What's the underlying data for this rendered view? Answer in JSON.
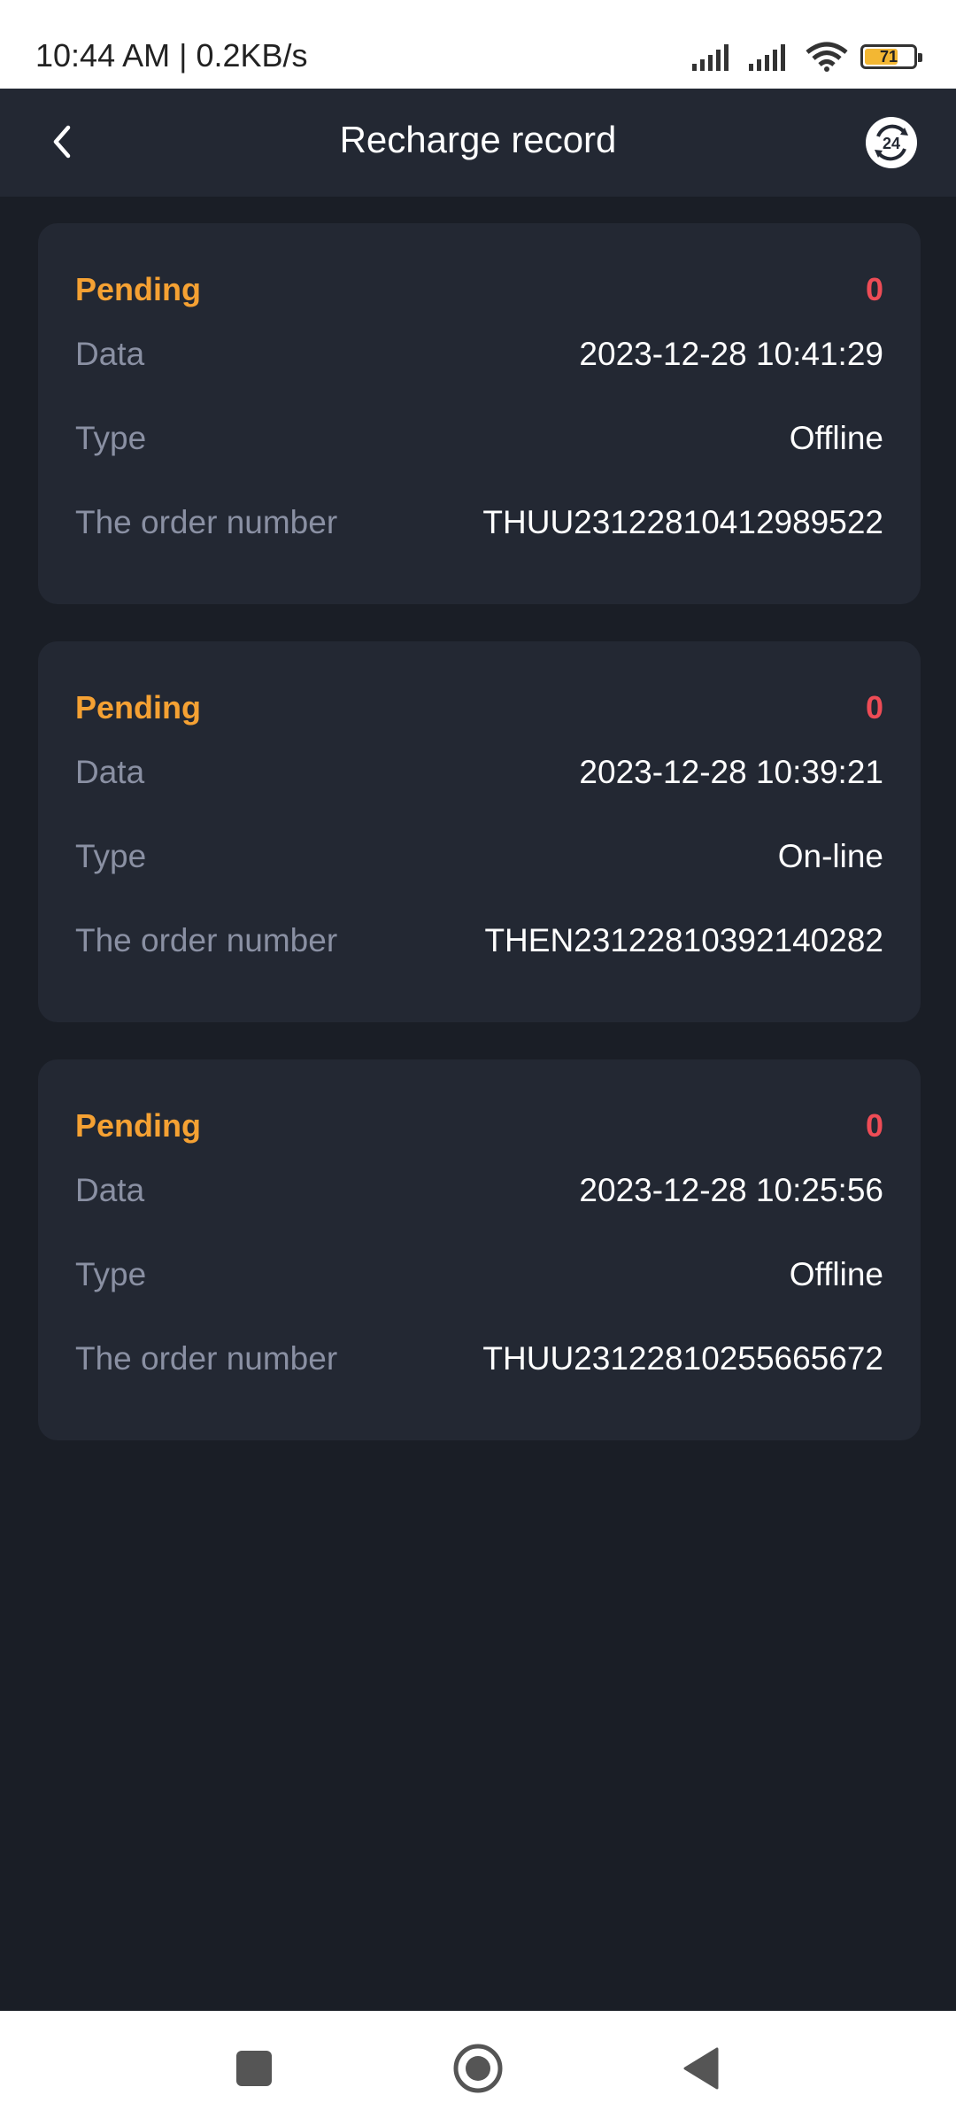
{
  "status_bar": {
    "time": "10:44 AM | 0.2KB/s",
    "battery_level": "71",
    "battery_fraction": 0.71,
    "battery_color": "#f3b733"
  },
  "header": {
    "title": "Recharge record",
    "back_icon": "chevron-left-icon",
    "support_icon": "support-24h-icon",
    "support_badge": "24"
  },
  "colors": {
    "status_pending": "#f5a133",
    "amount": "#ee4c56",
    "background": "#1a1e26",
    "card": "#232833"
  },
  "records": [
    {
      "status": "Pending",
      "amount": "0",
      "date_label": "Data",
      "date": "2023-12-28 10:41:29",
      "type_label": "Type",
      "type": "Offline",
      "order_label": "The order number",
      "order_number": "THUU23122810412989522"
    },
    {
      "status": "Pending",
      "amount": "0",
      "date_label": "Data",
      "date": "2023-12-28 10:39:21",
      "type_label": "Type",
      "type": "On-line",
      "order_label": "The order number",
      "order_number": "THEN23122810392140282"
    },
    {
      "status": "Pending",
      "amount": "0",
      "date_label": "Data",
      "date": "2023-12-28 10:25:56",
      "type_label": "Type",
      "type": "Offline",
      "order_label": "The order number",
      "order_number": "THUU23122810255665672"
    }
  ],
  "nav_bar": {
    "recents_icon": "square-icon",
    "home_icon": "circle-home-icon",
    "back_icon": "triangle-back-icon"
  }
}
